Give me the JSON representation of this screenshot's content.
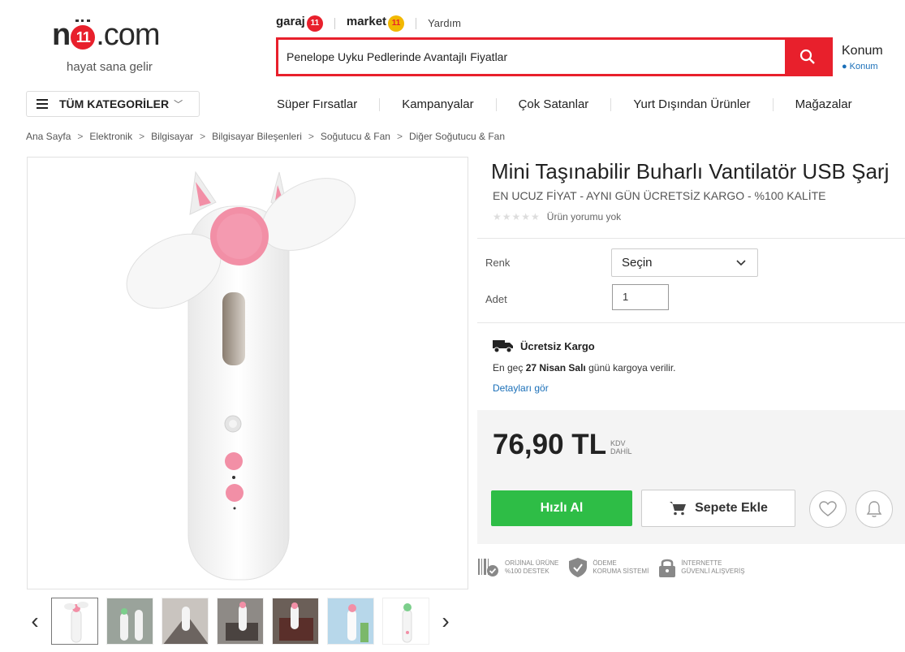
{
  "header": {
    "logo": {
      "brand": "n11.com",
      "tagline": "hayat sana gelir"
    },
    "brand_links": {
      "garaj": "garaj",
      "garaj_badge": "11",
      "market": "market",
      "market_badge": "11",
      "help": "Yardım"
    },
    "search": {
      "value": "Penelope Uyku Pedlerinde Avantajlı Fiyatlar",
      "button_icon": "search-icon"
    },
    "location": {
      "title": "Konum",
      "sub": "Konum"
    }
  },
  "nav": {
    "categories_label": "TÜM KATEGORİLER",
    "links": [
      "Süper Fırsatlar",
      "Kampanyalar",
      "Çok Satanlar",
      "Yurt Dışından Ürünler",
      "Mağazalar"
    ]
  },
  "breadcrumb": [
    "Ana Sayfa",
    "Elektronik",
    "Bilgisayar",
    "Bilgisayar Bileşenleri",
    "Soğutucu & Fan",
    "Diğer Soğutucu & Fan"
  ],
  "product": {
    "title": "Mini Taşınabilir Buharlı Vantilatör USB Şarj",
    "subtitle": "EN UCUZ FİYAT - AYNI GÜN ÜCRETSİZ KARGO - %100 KALİTE",
    "rating": {
      "stars": 0,
      "text": "Ürün yorumu yok"
    },
    "options": {
      "color_label": "Renk",
      "color_value": "Seçin",
      "qty_label": "Adet",
      "qty_value": "1"
    },
    "cargo": {
      "title": "Ücretsiz Kargo",
      "line_prefix": "En geç",
      "line_date": "27 Nisan Salı",
      "line_suffix": "günü kargoya verilir.",
      "details_link": "Detayları gör"
    },
    "price": {
      "amount": "76,90 TL",
      "kdv_line1": "KDV",
      "kdv_line2": "DAHİL"
    },
    "buttons": {
      "buy": "Hızlı Al",
      "cart": "Sepete Ekle"
    },
    "badges": [
      {
        "line1": "ORİJİNAL ÜRÜNE",
        "line2": "%100 DESTEK"
      },
      {
        "line1": "ÖDEME",
        "line2": "KORUMA SİSTEMİ"
      },
      {
        "line1": "İNTERNETTE",
        "line2": "GÜVENLİ ALIŞVERİŞ"
      }
    ]
  },
  "gallery": {
    "thumbnail_count": 7,
    "active_index": 0
  },
  "colors": {
    "brand_red": "#e8202c",
    "buy_green": "#2ebd46",
    "link_blue": "#1a6fb8",
    "fan_pink": "#f28fa6"
  }
}
